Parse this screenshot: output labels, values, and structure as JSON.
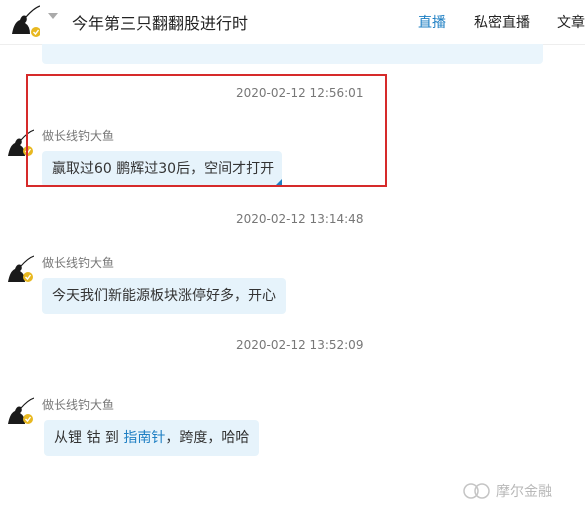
{
  "header": {
    "title": "今年第三只翻翻股进行时",
    "tabs": [
      {
        "label": "直播",
        "active": true
      },
      {
        "label": "私密直播",
        "active": false
      },
      {
        "label": "文章",
        "active": false
      }
    ]
  },
  "messages": [
    {
      "timestamp": "2020-02-12 12:56:01",
      "sender": "做长线钓大鱼",
      "text": "赢取过60 鹏辉过30后，空间才打开"
    },
    {
      "timestamp": "2020-02-12 13:14:48",
      "sender": "做长线钓大鱼",
      "text": "今天我们新能源板块涨停好多，开心"
    },
    {
      "timestamp": "2020-02-12 13:52:09",
      "sender": "做长线钓大鱼",
      "text_before": "从锂 钴 到 ",
      "link": "指南针",
      "text_after": "，跨度，哈哈"
    }
  ],
  "watermark": "摩尔金融",
  "colors": {
    "accent": "#1e7fc3",
    "bubble": "#e6f3fb",
    "highlight": "#d62a2a"
  },
  "icons": {
    "avatar": "fisherman-avatar-icon",
    "badge": "vip-badge-icon",
    "caret": "chevron-down-icon"
  }
}
